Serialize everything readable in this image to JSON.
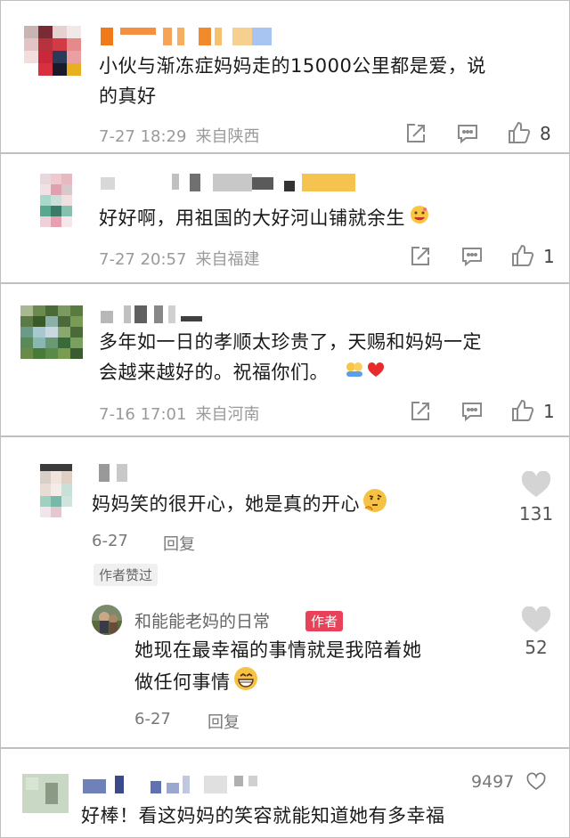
{
  "comments": [
    {
      "text_line1": "小伙与渐冻症妈妈走的15000公里都是爱，说",
      "text_line2": "的真好",
      "date": "7-27 18:29",
      "location": "来自陕西",
      "likes": "8"
    },
    {
      "text": "好好啊，用祖国的大好河山铺就余生",
      "date": "7-27 20:57",
      "location": "来自福建",
      "likes": "1"
    },
    {
      "text_line1": "多年如一日的孝顺太珍贵了，天赐和妈妈一定",
      "text_line2": "会越来越好的。祝福你们。",
      "date": "7-16 17:01",
      "location": "来自河南",
      "likes": "1"
    }
  ],
  "thread": {
    "text": "妈妈笑的很开心，她是真的开心",
    "date": "6-27",
    "reply_label": "回复",
    "author_liked": "作者赞过",
    "likes": "131",
    "reply": {
      "username": "和能能老妈的日常",
      "author_tag": "作者",
      "text_line1": "她现在最幸福的事情就是我陪着她",
      "text_line2": "做任何事情",
      "date": "6-27",
      "reply_label": "回复",
      "likes": "52"
    }
  },
  "last_comment": {
    "text": "好棒！看这妈妈的笑容就能知道她有多幸福",
    "likes": "9497"
  },
  "icons": {
    "share": "share-icon",
    "comment": "comment-icon",
    "like": "thumbs-up-icon",
    "heart": "heart-icon"
  },
  "colors": {
    "author_tag": "#e8415a",
    "meta_text": "#9a9a9a"
  }
}
